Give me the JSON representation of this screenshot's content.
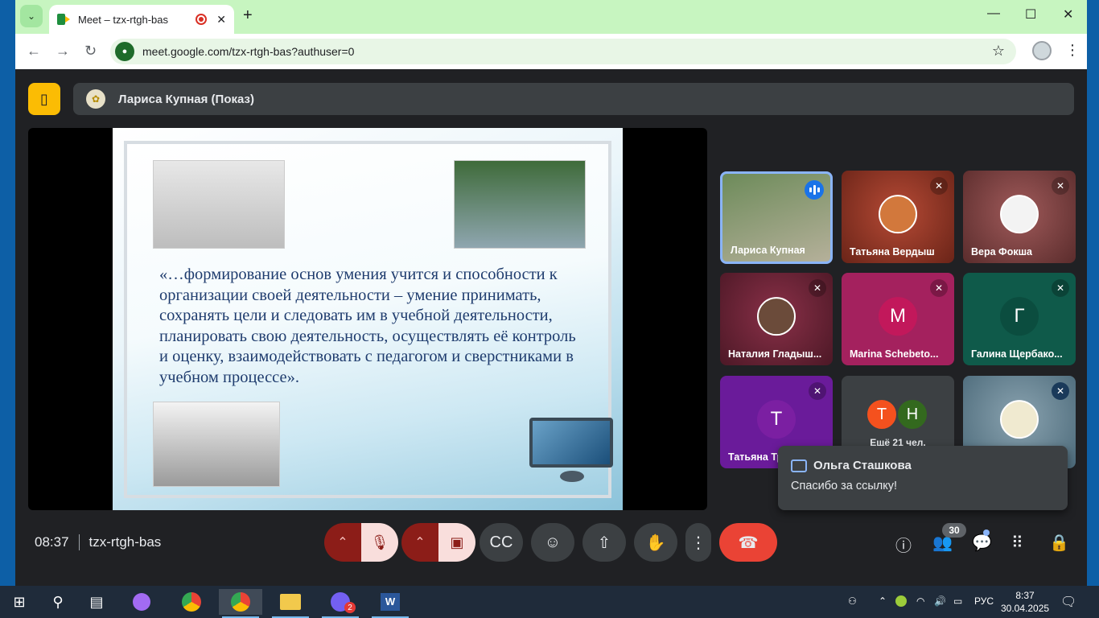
{
  "browser": {
    "tab_title": "Meet – tzx-rtgh-bas",
    "url": "meet.google.com/tzx-rtgh-bas?authuser=0"
  },
  "presentation": {
    "presenter_label": "Лариса Купная (Показ)"
  },
  "slide": {
    "quote": "«…формирование основ умения учится и способности к организации своей деятельности – умение принимать, сохранять цели и следовать им в учебной деятельности, планировать свою деятельность, осуществлять её контроль и оценку, взаимодействовать с педагогом и сверстниками в учебном процессе»."
  },
  "participants": [
    {
      "name": "Лариса Купная",
      "type": "video",
      "active": true
    },
    {
      "name": "Татьяна Вердыш",
      "type": "avatar",
      "muted": true,
      "bg": "#9a3b2b"
    },
    {
      "name": "Вера Фокша",
      "type": "avatar",
      "muted": true,
      "bg": "#8a4a4a"
    },
    {
      "name": "Наталия Гладыш...",
      "type": "avatar",
      "muted": true,
      "bg": "#7a2a3c"
    },
    {
      "name": "Marina Schebeto...",
      "type": "letter",
      "letter": "M",
      "muted": true,
      "bg": "#a4215e",
      "circle": "#c2185b"
    },
    {
      "name": "Галина Щербако...",
      "type": "letter",
      "letter": "Г",
      "muted": true,
      "bg": "#0f5a4a",
      "circle": "#0b4d3f"
    },
    {
      "name": "Татьяна Три...",
      "type": "letter",
      "letter": "Т",
      "muted": true,
      "bg": "#6a1b9a",
      "circle": "#7b1fa2"
    },
    {
      "name": "Ещё 21 чел.",
      "type": "more",
      "letters": [
        "Т",
        "Н"
      ]
    },
    {
      "name": "",
      "type": "avatar",
      "muted": true,
      "bg": "#5a7a8a"
    }
  ],
  "toast": {
    "sender": "Ольга Сташкова",
    "message": "Спасибо за ссылку!"
  },
  "meeting": {
    "time": "08:37",
    "code": "tzx-rtgh-bas",
    "participant_count": "30"
  },
  "taskbar": {
    "lang": "РУС",
    "time": "8:37",
    "date": "30.04.2025",
    "viber_badge": "2"
  }
}
